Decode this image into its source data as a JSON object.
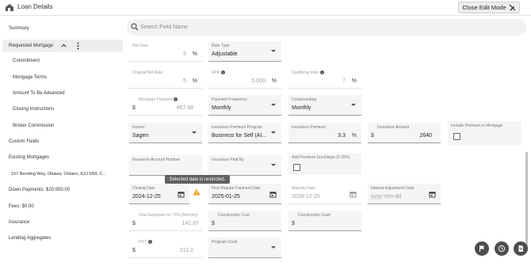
{
  "header": {
    "title": "Loan Details",
    "edit_button": "Close Edit Mode",
    "logo_icon": "house-icon",
    "edit_icon": "pencil-off-icon"
  },
  "sidebar": {
    "items": [
      {
        "label": "Summary"
      },
      {
        "label": "Requested Mortgage"
      },
      {
        "label": "Commitment"
      },
      {
        "label": "Mortgage Terms"
      },
      {
        "label": "Amount To Be Advanced"
      },
      {
        "label": "Closing Instructions"
      },
      {
        "label": "Broker Commission"
      },
      {
        "label": "Custom Fields"
      },
      {
        "label": "Existing Mortgages"
      },
      {
        "label": "157 Bending Way, Ottawa, Ontario, K2J 6N9, C..."
      },
      {
        "label": "Down Payments: $20,000.00"
      },
      {
        "label": "Fees: $0.00"
      },
      {
        "label": "Insurance"
      },
      {
        "label": "Lending Aggregates"
      }
    ]
  },
  "search": {
    "placeholder": "Search Field Name"
  },
  "fields": {
    "net_rate": {
      "label": "Net Rate",
      "value": "5",
      "unit": "%"
    },
    "rate_type": {
      "label": "Rate Type",
      "value": "Adjustable"
    },
    "original_net_rate": {
      "label": "Original Net Rate",
      "value": "5",
      "unit": "%"
    },
    "apr": {
      "label": "APR",
      "value": "5.000",
      "unit": "%"
    },
    "qualifying_rate": {
      "label": "Qualifying Rate",
      "value": "7",
      "unit": "%"
    },
    "mortgage_payment": {
      "label": "Mortgage Payment",
      "prefix": "$",
      "value": "467.68"
    },
    "payment_frequency": {
      "label": "Payment Frequency",
      "value": "Monthly"
    },
    "compounding": {
      "label": "Compounding",
      "value": "Monthly"
    },
    "insurer": {
      "label": "Insurer",
      "value": "Sagen"
    },
    "insurance_premium_program": {
      "label": "Insurance Premium Program",
      "value": "Business for Self (Al..."
    },
    "insurance_premium": {
      "label": "Insurance Premium",
      "value": "3.3",
      "unit": "%"
    },
    "insurance_amount": {
      "label": "Insurance Amount",
      "prefix": "$",
      "value": "2640"
    },
    "include_premium": {
      "label": "Include Premium in Mortgage"
    },
    "insurance_account_number": {
      "label": "Insurance Account Number",
      "value": ""
    },
    "insurance_paid_by": {
      "label": "Insurance Paid By",
      "value": ""
    },
    "add_premium_surcharge": {
      "label": "Add Premium Surcharge (0.20%)"
    },
    "closing_date": {
      "label": "Closing Date",
      "value": "2024-12-25"
    },
    "first_regular_payment_date": {
      "label": "First Regular Payment Date",
      "value": "2025-01-25"
    },
    "maturity_date": {
      "label": "Maturity Date",
      "value": "2029-12-25"
    },
    "interest_adjustment_date": {
      "label": "Interest Adjustment Date",
      "placeholder": "yyyy-mm-dd"
    },
    "total_expenses_tds": {
      "label": "Total Expenses for TDS (Monthly)",
      "prefix": "$",
      "value": "141.67"
    },
    "construction_cost": {
      "label": "Construction Cost",
      "prefix": "$",
      "value": ""
    },
    "construction_cash": {
      "label": "Construction Cash",
      "prefix": "$",
      "value": ""
    },
    "pst": {
      "label": "PST",
      "prefix": "$",
      "value": "211.2"
    },
    "program_code": {
      "label": "Program Code",
      "value": ""
    }
  },
  "tooltip": "Selected date is restricted.",
  "fab": [
    "flag-icon",
    "history-icon",
    "document-icon"
  ]
}
